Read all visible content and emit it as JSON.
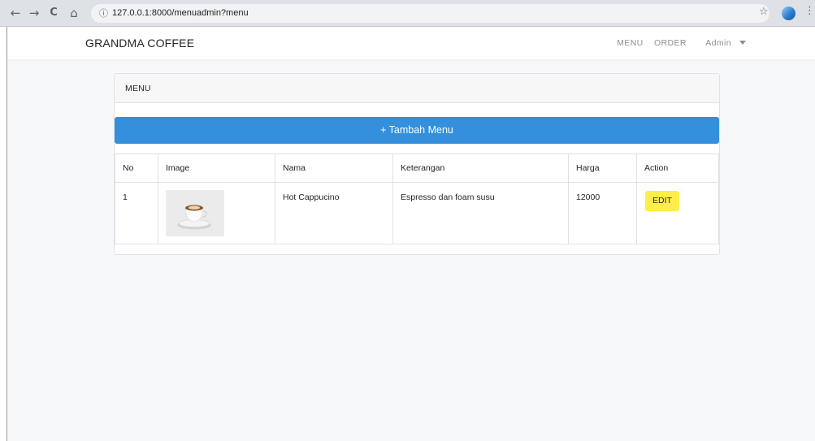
{
  "browser": {
    "url": "127.0.0.1:8000/menuadmin?menu",
    "back_icon": "←",
    "forward_icon": "→",
    "reload_icon": "C",
    "home_icon": "⌂",
    "info_icon": "ⓘ",
    "star_icon": "☆",
    "menu_icon": "⋮"
  },
  "navbar": {
    "brand": "GRANDMA COFFEE",
    "links": [
      "MENU",
      "ORDER",
      "Admin"
    ]
  },
  "card": {
    "title": "MENU",
    "add_button": "+ Tambah Menu",
    "table": {
      "headers": [
        "No",
        "Image",
        "Nama",
        "Keterangan",
        "Harga",
        "Action"
      ],
      "rows": [
        {
          "no": "1",
          "nama": "Hot Cappucino",
          "keterangan": "Espresso dan foam susu",
          "harga": "12000",
          "action": "EDIT"
        }
      ]
    }
  },
  "colors": {
    "primary": "#3490dc",
    "warning": "#ffed4a"
  }
}
